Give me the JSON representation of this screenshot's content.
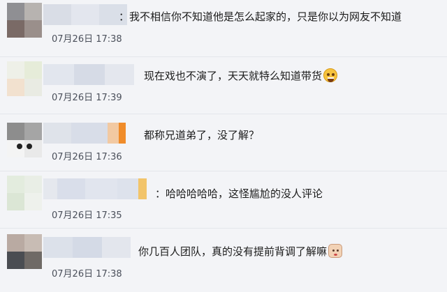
{
  "comments": [
    {
      "text": "：我不相信你不知道他是怎么起家的，只是你以为网友不知道",
      "time": "07月26日 17:38",
      "emoji": ""
    },
    {
      "text": "现在戏也不演了，天天就特么知道带货",
      "time": "07月26日 17:39",
      "emoji": "cold-sweat-face-icon"
    },
    {
      "text": "都称兄道弟了，没了解？",
      "time": "07月26日 17:36",
      "emoji": ""
    },
    {
      "text": "：哈哈哈哈哈，这怪尴尬的没人评论",
      "time": "07月26日 17:35",
      "emoji": ""
    },
    {
      "text": "你几百人团队，真的没有提前背调了解嘛",
      "time": "07月26日 17:38",
      "emoji": "face-emoji-icon"
    }
  ],
  "colors": {
    "background": "#f3f4f7",
    "text": "#1b1b1b",
    "time": "#4a4f5a",
    "divider": "#e4e6eb"
  }
}
